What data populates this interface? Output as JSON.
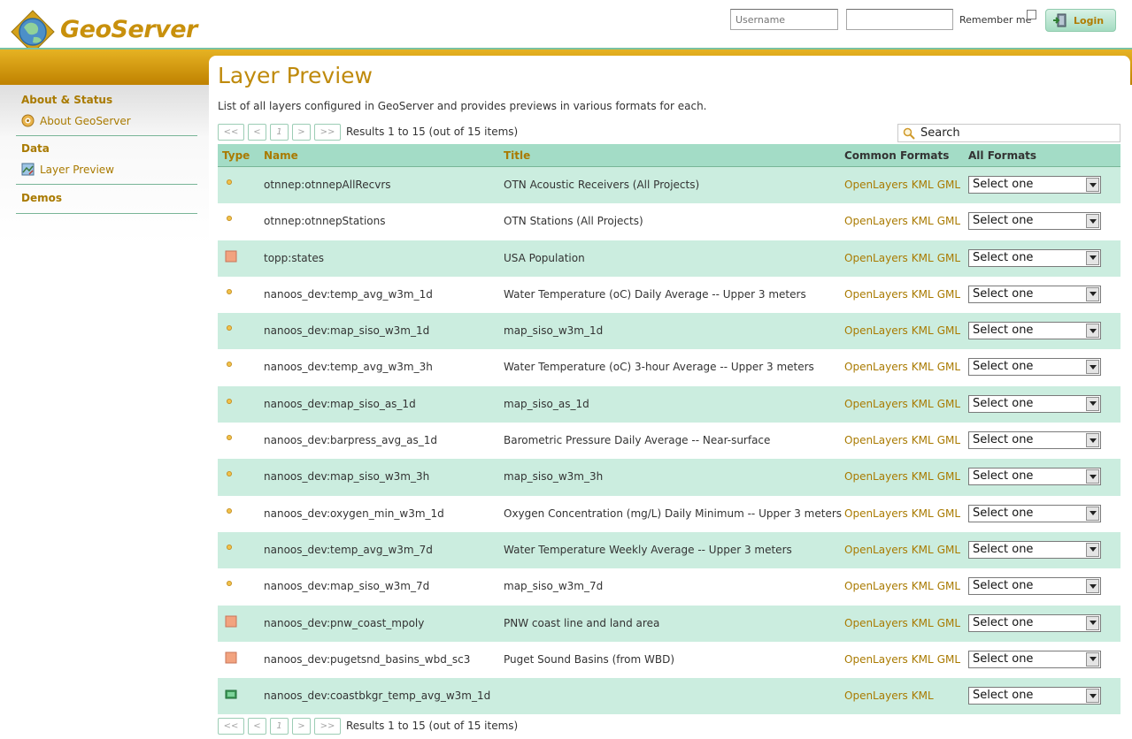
{
  "header": {
    "logo_text": "GeoServer",
    "username_placeholder": "Username",
    "password_placeholder": "",
    "remember_label": "Remember me",
    "login_label": "Login"
  },
  "sidebar": {
    "sections": [
      {
        "title": "About & Status",
        "items": [
          {
            "label": "About GeoServer",
            "icon": "info-icon"
          }
        ]
      },
      {
        "title": "Data",
        "items": [
          {
            "label": "Layer Preview",
            "icon": "map-preview-icon"
          }
        ]
      },
      {
        "title": "Demos",
        "items": []
      }
    ]
  },
  "main": {
    "title": "Layer Preview",
    "description": "List of all layers configured in GeoServer and provides previews in various formats for each.",
    "pager": {
      "first": "<<",
      "prev": "<",
      "current": "1",
      "next": ">",
      "last": ">>",
      "results_text": "Results 1 to 15 (out of 15 items)"
    },
    "search_placeholder": "Search",
    "columns": {
      "type": "Type",
      "name": "Name",
      "title": "Title",
      "common_formats": "Common Formats",
      "all_formats": "All Formats"
    },
    "select_default": "Select one",
    "rows": [
      {
        "type": "point",
        "name": "otnnep:otnnepAllRecvrs",
        "title": "OTN Acoustic Receivers (All Projects)",
        "formats": [
          "OpenLayers",
          "KML",
          "GML"
        ]
      },
      {
        "type": "point",
        "name": "otnnep:otnnepStations",
        "title": "OTN Stations (All Projects)",
        "formats": [
          "OpenLayers",
          "KML",
          "GML"
        ]
      },
      {
        "type": "polygon",
        "name": "topp:states",
        "title": "USA Population",
        "formats": [
          "OpenLayers",
          "KML",
          "GML"
        ]
      },
      {
        "type": "point",
        "name": "nanoos_dev:temp_avg_w3m_1d",
        "title": "Water Temperature (oC) Daily Average -- Upper 3 meters",
        "formats": [
          "OpenLayers",
          "KML",
          "GML"
        ]
      },
      {
        "type": "point",
        "name": "nanoos_dev:map_siso_w3m_1d",
        "title": "map_siso_w3m_1d",
        "formats": [
          "OpenLayers",
          "KML",
          "GML"
        ]
      },
      {
        "type": "point",
        "name": "nanoos_dev:temp_avg_w3m_3h",
        "title": "Water Temperature (oC) 3-hour Average -- Upper 3 meters",
        "formats": [
          "OpenLayers",
          "KML",
          "GML"
        ]
      },
      {
        "type": "point",
        "name": "nanoos_dev:map_siso_as_1d",
        "title": "map_siso_as_1d",
        "formats": [
          "OpenLayers",
          "KML",
          "GML"
        ]
      },
      {
        "type": "point",
        "name": "nanoos_dev:barpress_avg_as_1d",
        "title": "Barometric Pressure Daily Average -- Near-surface",
        "formats": [
          "OpenLayers",
          "KML",
          "GML"
        ]
      },
      {
        "type": "point",
        "name": "nanoos_dev:map_siso_w3m_3h",
        "title": "map_siso_w3m_3h",
        "formats": [
          "OpenLayers",
          "KML",
          "GML"
        ]
      },
      {
        "type": "point",
        "name": "nanoos_dev:oxygen_min_w3m_1d",
        "title": "Oxygen Concentration (mg/L) Daily Minimum -- Upper 3 meters",
        "formats": [
          "OpenLayers",
          "KML",
          "GML"
        ]
      },
      {
        "type": "point",
        "name": "nanoos_dev:temp_avg_w3m_7d",
        "title": "Water Temperature Weekly Average -- Upper 3 meters",
        "formats": [
          "OpenLayers",
          "KML",
          "GML"
        ]
      },
      {
        "type": "point",
        "name": "nanoos_dev:map_siso_w3m_7d",
        "title": "map_siso_w3m_7d",
        "formats": [
          "OpenLayers",
          "KML",
          "GML"
        ]
      },
      {
        "type": "polygon",
        "name": "nanoos_dev:pnw_coast_mpoly",
        "title": "PNW coast line and land area",
        "formats": [
          "OpenLayers",
          "KML",
          "GML"
        ]
      },
      {
        "type": "polygon",
        "name": "nanoos_dev:pugetsnd_basins_wbd_sc3",
        "title": "Puget Sound Basins (from WBD)",
        "formats": [
          "OpenLayers",
          "KML",
          "GML"
        ]
      },
      {
        "type": "raster",
        "name": "nanoos_dev:coastbkgr_temp_avg_w3m_1d",
        "title": "",
        "formats": [
          "OpenLayers",
          "KML"
        ]
      }
    ]
  },
  "colors": {
    "brand_gold": "#bf8a0c",
    "link_gold": "#a97a00",
    "table_header": "#a3dcc6",
    "row_alt": "#cbeddf",
    "accent_green": "#78b597"
  }
}
